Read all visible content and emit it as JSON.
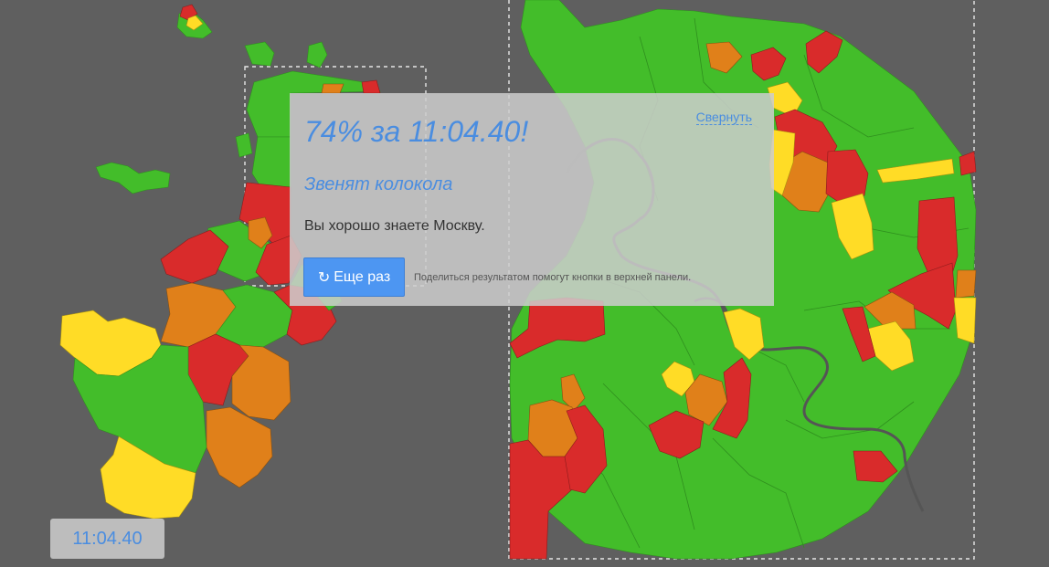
{
  "result": {
    "score_line": "74% за 11:04.40!",
    "rank_title": "Звенят колокола",
    "verdict": "Вы хорошо знаете Москву.",
    "collapse_label": "Свернуть",
    "retry_label": "Еще раз",
    "retry_icon": "refresh-icon",
    "share_hint": "Поделиться результатом помогут кнопки в верхней панели."
  },
  "timer": {
    "value": "11:04.40"
  },
  "map": {
    "legend_colors": {
      "correct_first_try": "#43bd2a",
      "correct_second_try": "#ffdc26",
      "correct_third_try": "#e0801a",
      "missed": "#d92b2b"
    },
    "background": "#5f5f5f",
    "river_color": "#555555"
  }
}
